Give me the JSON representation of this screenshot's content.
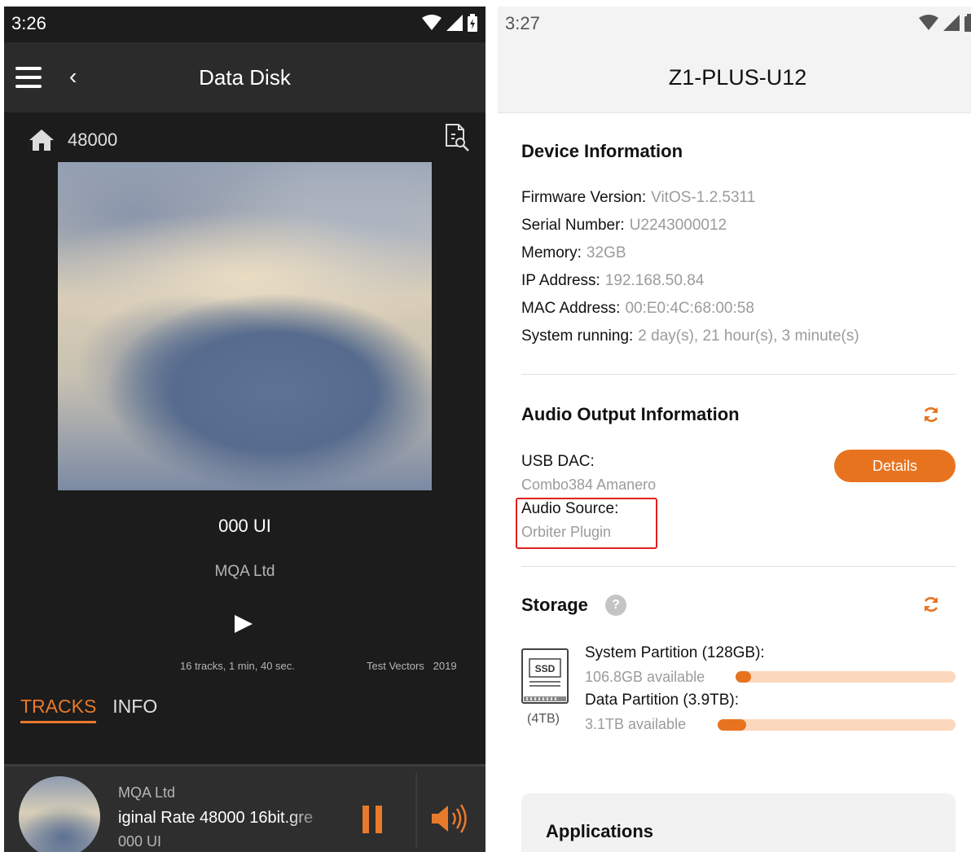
{
  "left": {
    "status_time": "3:26",
    "title": "Data Disk",
    "breadcrumb": "48000",
    "track_title": "000 UI",
    "artist": "MQA Ltd",
    "tracks_info": "16 tracks, 1 min, 40 sec.",
    "album_label": "Test Vectors   2019",
    "tabs": {
      "tracks": "TRACKS",
      "info": "INFO"
    },
    "player": {
      "artist": "MQA Ltd",
      "rate_text": "iginal Rate 48000 16bit.gre",
      "title": "000 UI"
    },
    "accent": "#e87a2a"
  },
  "right": {
    "status_time": "3:27",
    "title": "Z1-PLUS-U12",
    "device_heading": "Device Information",
    "device_rows": [
      {
        "label": "Firmware Version:",
        "value": "VitOS-1.2.5311"
      },
      {
        "label": "Serial Number:",
        "value": "U2243000012"
      },
      {
        "label": "Memory:",
        "value": "32GB"
      },
      {
        "label": "IP Address:",
        "value": "192.168.50.84"
      },
      {
        "label": "MAC Address:",
        "value": "00:E0:4C:68:00:58"
      },
      {
        "label": "System running:",
        "value": "2 day(s), 21 hour(s), 3 minute(s)"
      }
    ],
    "audio_heading": "Audio Output Information",
    "usb_label": "USB DAC:",
    "usb_value": "Combo384 Amanero",
    "details_label": "Details",
    "source_label": "Audio Source:",
    "source_value": "Orbiter Plugin",
    "storage_heading": "Storage",
    "help_glyph": "?",
    "ssd_label": "SSD",
    "ssd_capacity": "(4TB)",
    "partitions": [
      {
        "label": "System Partition (128GB):",
        "available": "106.8GB available",
        "used_fraction": 0.07
      },
      {
        "label": "Data Partition (3.9TB):",
        "available": "3.1TB available",
        "used_fraction": 0.12
      }
    ],
    "applications_heading": "Applications",
    "accent": "#e8731f"
  }
}
